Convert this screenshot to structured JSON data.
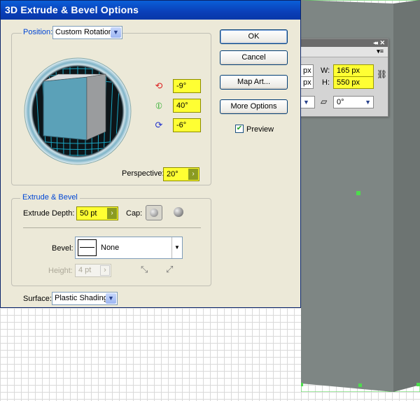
{
  "dialog": {
    "title": "3D Extrude & Bevel Options",
    "position": {
      "label": "Position:",
      "value": "Custom Rotation"
    },
    "rotation": {
      "x": "-9°",
      "y": "40°",
      "z": "-6°"
    },
    "perspective": {
      "label": "Perspective:",
      "value": "20°"
    },
    "buttons": {
      "ok": "OK",
      "cancel": "Cancel",
      "map_art": "Map Art...",
      "more_options": "More Options"
    },
    "preview": {
      "label": "Preview",
      "checked": true
    },
    "extrude_bevel": {
      "legend": "Extrude & Bevel",
      "depth_label": "Extrude Depth:",
      "depth_value": "50 pt",
      "cap_label": "Cap:",
      "bevel_label": "Bevel:",
      "bevel_value": "None",
      "height_label": "Height:",
      "height_value": "4 pt"
    },
    "surface": {
      "label": "Surface:",
      "value": "Plastic Shading"
    }
  },
  "transform_panel": {
    "x_unit": "px",
    "y_unit": "px",
    "w_label": "W:",
    "w_value": "165 px",
    "h_label": "H:",
    "h_value": "550 px",
    "shear_value": "0°"
  },
  "colors": {
    "highlight": "#ffff33",
    "titlebar": "#0a4fd0",
    "dialog_bg": "#ece9d8",
    "cube_front": "#5ba1b8",
    "shape": "#7e8684"
  }
}
